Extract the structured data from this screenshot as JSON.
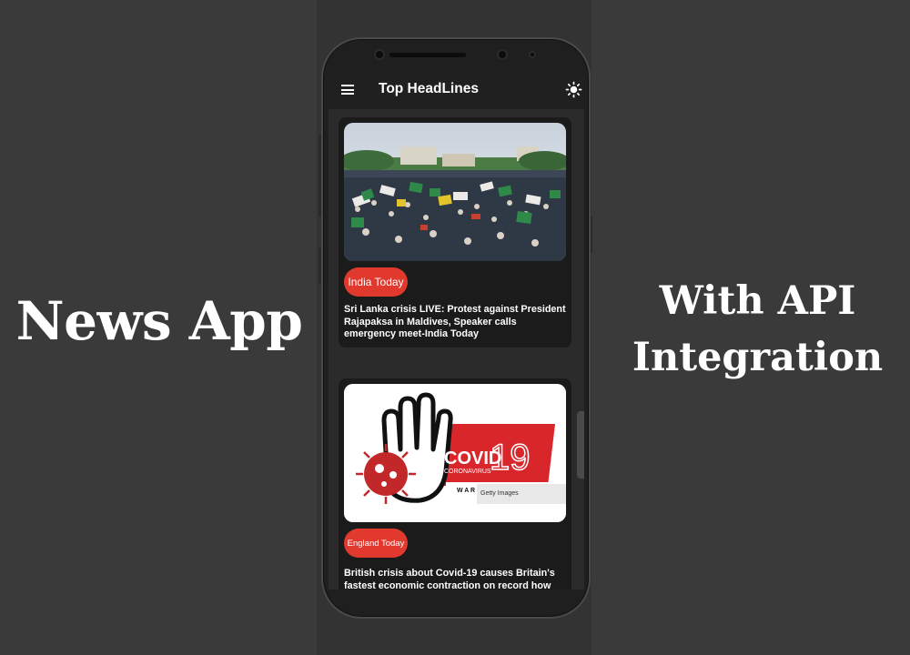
{
  "promo": {
    "left_text": "News App",
    "right_line1": "With API",
    "right_line2": "Integration"
  },
  "appbar": {
    "title": "Top HeadLines",
    "menu_icon": "hamburger-menu-icon",
    "theme_icon": "sun-icon"
  },
  "articles": [
    {
      "source": "India Today",
      "headline": "Sri Lanka crisis LIVE: Protest against President Rajapaksa in Maldives, Speaker calls emergency meet-India Today",
      "image": "protest-crowd-photo"
    },
    {
      "source": "England Today",
      "headline": "British crisis about Covid-19 causes Britain's fastest economic contraction on record how",
      "image": "covid-19-hand-graphic",
      "image_text": {
        "covid": "COVID",
        "nineteen": "19",
        "coronavirus": "CORONAVIRUS",
        "war": "W A R",
        "watermark": "Getty Images"
      }
    }
  ],
  "colors": {
    "background": "#3a3a3a",
    "appbar": "#202020",
    "card": "#1b1b1b",
    "badge": "#e2392f",
    "covid_red": "#d9262b"
  }
}
